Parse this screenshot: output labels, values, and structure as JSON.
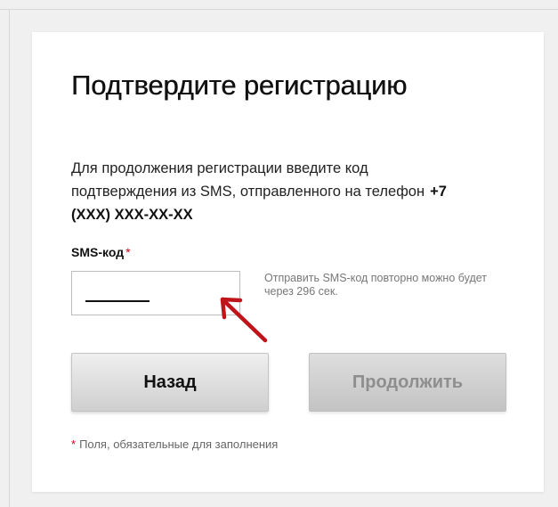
{
  "form": {
    "title": "Подтвердите регистрацию",
    "description": "Для продолжения регистрации введите код подтверждения из SMS, отправленного на телефон",
    "phone": "+7 (XXX) XXX-XX-XX",
    "sms_label": "SMS-код",
    "required_mark": "*",
    "sms_value": "",
    "resend_note": "Отправить SMS-код повторно можно будет через 296 сек.",
    "back_label": "Назад",
    "continue_label": "Продолжить",
    "required_note": "Поля, обязательные для заполнения"
  },
  "colors": {
    "required": "#d0021b",
    "annotation_arrow": "#c0141b"
  },
  "icons": {
    "annotation": "arrow-pointer-icon"
  }
}
